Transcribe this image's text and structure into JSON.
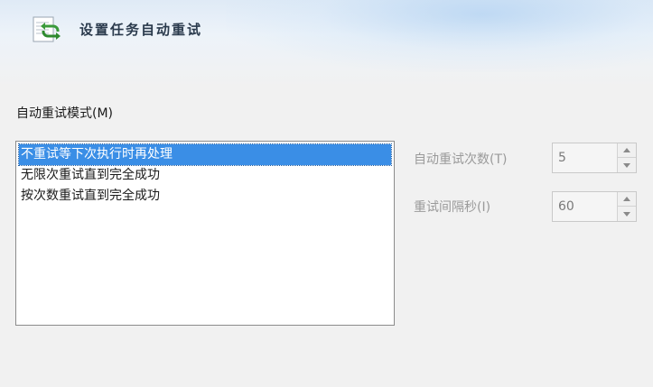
{
  "dialog": {
    "title": "设置任务自动重试",
    "icon": "retry-arrows-icon"
  },
  "mode": {
    "label": "自动重试模式(M)",
    "options": [
      "不重试等下次执行时再处理",
      "无限次重试直到完全成功",
      "按次数重试直到完全成功"
    ],
    "selected_index": 0
  },
  "retry_count": {
    "label": "自动重试次数(T)",
    "value": "5",
    "enabled": false
  },
  "retry_interval": {
    "label": "重试间隔秒(I)",
    "value": "60",
    "enabled": false
  },
  "colors": {
    "selection": "#3a8ee6",
    "disabled_text": "#9a9a9a",
    "icon_green": "#3a9a3a"
  }
}
